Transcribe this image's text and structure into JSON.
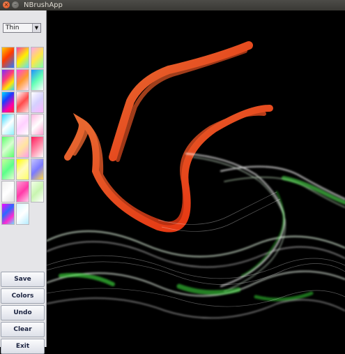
{
  "window": {
    "title": "NBrushApp"
  },
  "titlebar_buttons": {
    "close_glyph": "×",
    "minimize_glyph": "–"
  },
  "brush": {
    "selected": "Thin",
    "arrow": "▼"
  },
  "palette": {
    "swatches": [
      [
        "#ff3b00",
        "#fff200",
        "#ff8ad8"
      ],
      [
        "#7a2cff",
        "#ff4bd2",
        "#1f8fff"
      ],
      [
        "#00c4ff",
        "#ff2f2f",
        "#f7f7ff"
      ],
      [
        "#4bd1ff",
        "#ffd0ff",
        "#ffc2e2"
      ],
      [
        "#5cff6c",
        "#ffd1ff",
        "#ff1a5b"
      ],
      [
        "#c8ff9a",
        "#ffff00",
        "#c6c6ff"
      ],
      [
        "#f0f0f0",
        "#ff9fd6",
        "#f2ffe8"
      ],
      [
        "#ff00ff",
        "#d9f8ff"
      ]
    ]
  },
  "buttons": {
    "save": "Save",
    "colors": "Colors",
    "undo": "Undo",
    "clear": "Clear",
    "exit": "Exit"
  }
}
